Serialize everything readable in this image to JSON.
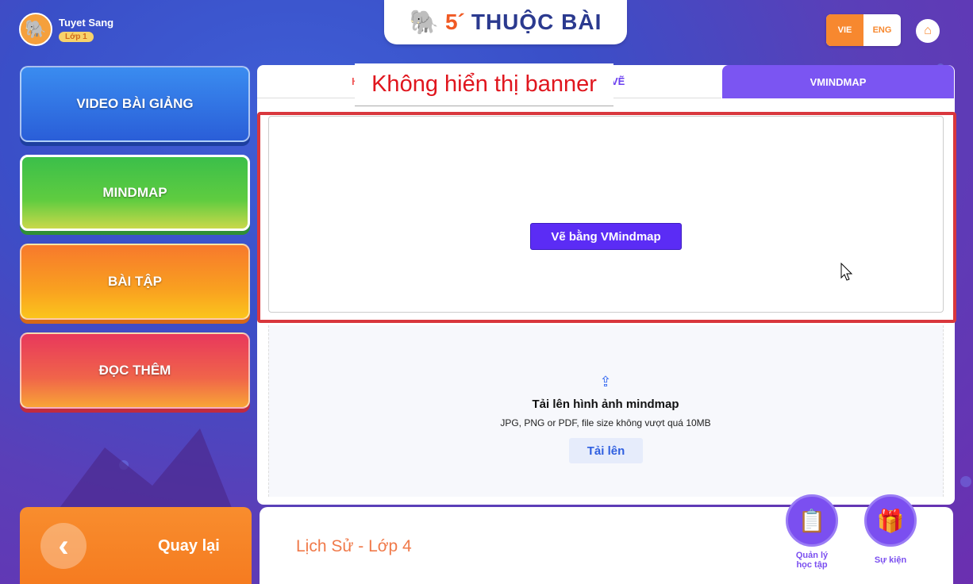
{
  "user": {
    "name": "Tuyet Sang",
    "class_label": "Lớp 1",
    "avatar_icon": "elephant-avatar-icon"
  },
  "logo": {
    "number": "5´",
    "text": "THUỘC BÀI",
    "icon": "elephant-logo-icon"
  },
  "language": {
    "vie": "VIE",
    "eng": "ENG",
    "active": "VIE"
  },
  "home_icon": "⌂",
  "sidebar": {
    "items": [
      {
        "label": "VIDEO BÀI GIẢNG"
      },
      {
        "label": "MINDMAP",
        "active": true
      },
      {
        "label": "BÀI TẬP"
      },
      {
        "label": "ĐỌC THÊM"
      }
    ]
  },
  "tabs": {
    "left_visible_fragment_start": "H",
    "left_visible_fragment_end": "VẼ",
    "right": "VMINDMAP"
  },
  "banner_note": "Không hiển thị banner",
  "draw": {
    "button_label": "Vẽ bằng VMindmap"
  },
  "upload": {
    "icon": "⇪",
    "title": "Tải lên hình ảnh mindmap",
    "hint": "JPG, PNG or PDF, file size không vượt quá 10MB",
    "button_label": "Tải lên"
  },
  "bottom": {
    "back_label": "Quay lại",
    "back_icon": "‹",
    "subject": "Lịch Sử - Lớp 4",
    "manage_label_line1": "Quản lý",
    "manage_label_line2": "học tập",
    "event_label": "Sự kiện"
  },
  "colors": {
    "accent_purple": "#5b2cf5",
    "tab_purple": "#7b55f2",
    "orange": "#f7882f",
    "annotation_red": "#d9373d"
  }
}
